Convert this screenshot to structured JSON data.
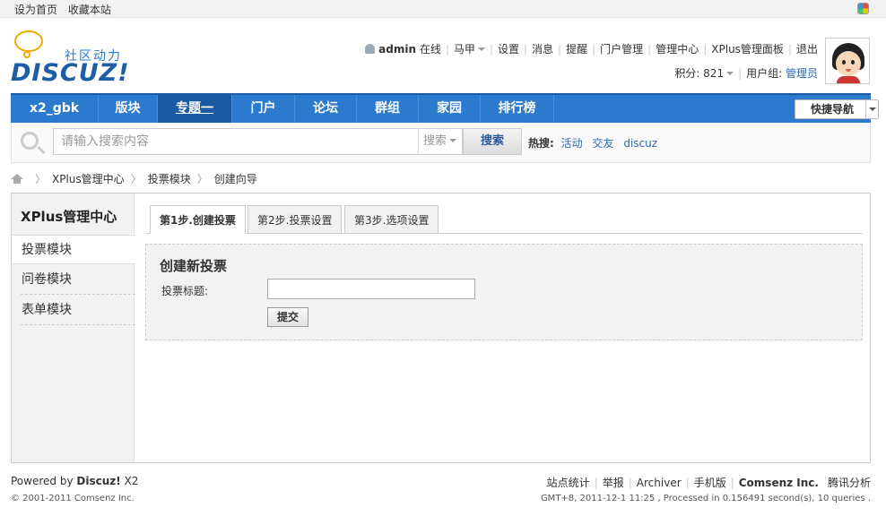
{
  "topbar": {
    "set_home": "设为首页",
    "bookmark": "收藏本站"
  },
  "logo": {
    "tagline": "社区动力",
    "word": "DISCUZ!"
  },
  "user": {
    "name": "admin",
    "status": "在线",
    "majia": "马甲",
    "menu": [
      "设置",
      "消息",
      "提醒",
      "门户管理",
      "管理中心",
      "XPlus管理面板",
      "退出"
    ],
    "points_label": "积分: 821",
    "group_label": "用户组: ",
    "group_value": "管理员"
  },
  "nav": {
    "items": [
      "x2_gbk",
      "版块",
      "专题一",
      "门户",
      "论坛",
      "群组",
      "家园",
      "排行榜"
    ],
    "active": "专题一",
    "quick_nav": "快捷导航"
  },
  "search": {
    "placeholder": "请输入搜索内容",
    "type": "搜索",
    "button": "搜索",
    "hot_label": "热搜:",
    "hot_keywords": [
      "活动",
      "交友",
      "discuz"
    ]
  },
  "breadcrumb": [
    "XPlus管理中心",
    "投票模块",
    "创建向导"
  ],
  "sidebar": {
    "title": "XPlus管理中心",
    "items": [
      "投票模块",
      "问卷模块",
      "表单模块"
    ]
  },
  "tabs": [
    "第1步.创建投票",
    "第2步.投票设置",
    "第3步.选项设置"
  ],
  "form": {
    "heading": "创建新投票",
    "title_label": "投票标题:",
    "title_value": "",
    "submit": "提交"
  },
  "footer": {
    "powered_prefix": "Powered by ",
    "powered_brand": "Discuz!",
    "powered_version": " X2",
    "copyright": "© 2001-2011 Comsenz Inc.",
    "links": [
      "站点统计",
      "举报",
      "Archiver",
      "手机版",
      "Comsenz Inc.",
      "腾讯分析"
    ],
    "processed": "GMT+8, 2011-12-1 11:25 , Processed in 0.156491 second(s), 10 queries ."
  }
}
